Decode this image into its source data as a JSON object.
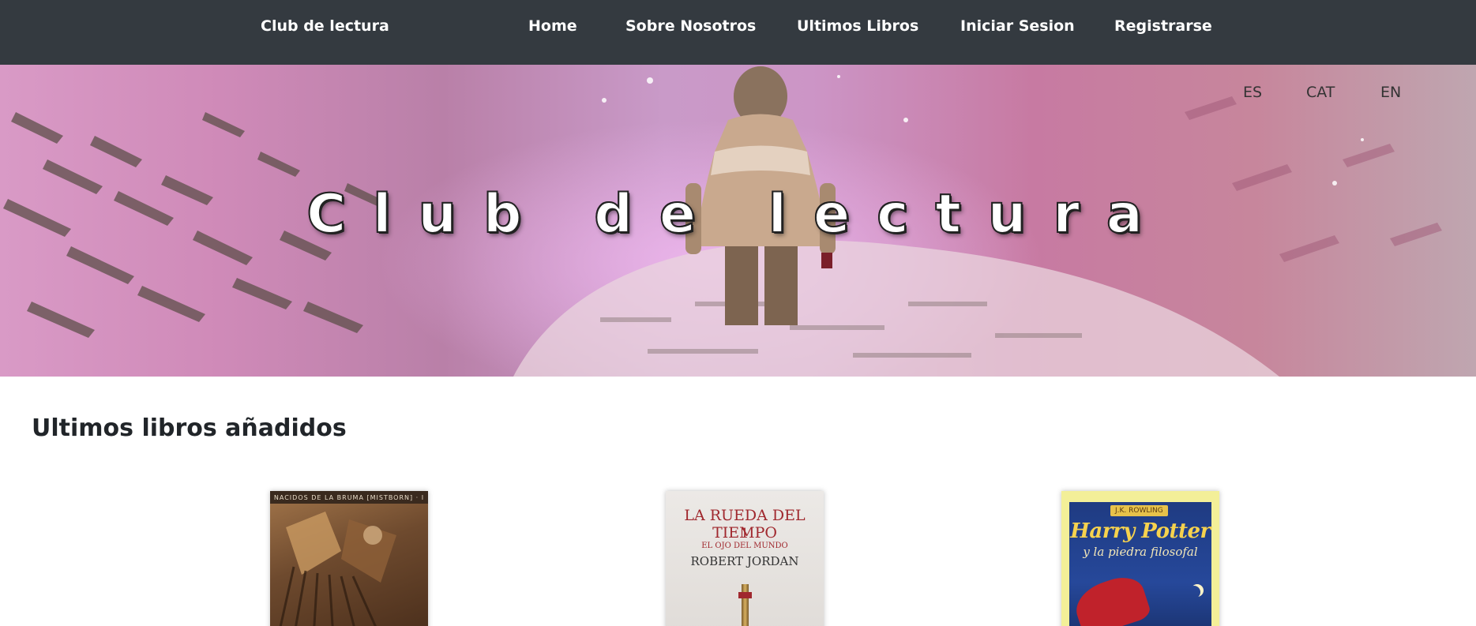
{
  "navbar": {
    "brand": "Club de lectura",
    "links": [
      {
        "label": "Home"
      },
      {
        "label": "Sobre Nosotros"
      },
      {
        "label": "Ultimos Libros"
      },
      {
        "label": "Iniciar Sesion"
      },
      {
        "label": "Registrarse"
      }
    ],
    "background": "#343a40"
  },
  "hero": {
    "title": "Club de lectura",
    "languages": [
      "ES",
      "CAT",
      "EN"
    ]
  },
  "latest": {
    "heading": "Ultimos libros añadidos",
    "books": [
      {
        "cover_text": "NACIDOS DE LA BRUMA [MISTBORN] · I"
      },
      {
        "series": "LA RUEDA DEL TIEMPO",
        "number": "1",
        "subtitle": "EL OJO DEL MUNDO",
        "author": "ROBERT JORDAN"
      },
      {
        "badge": "J.K. ROWLING",
        "title": "Harry Potter",
        "subtitle": "y la piedra filosofal"
      }
    ]
  }
}
